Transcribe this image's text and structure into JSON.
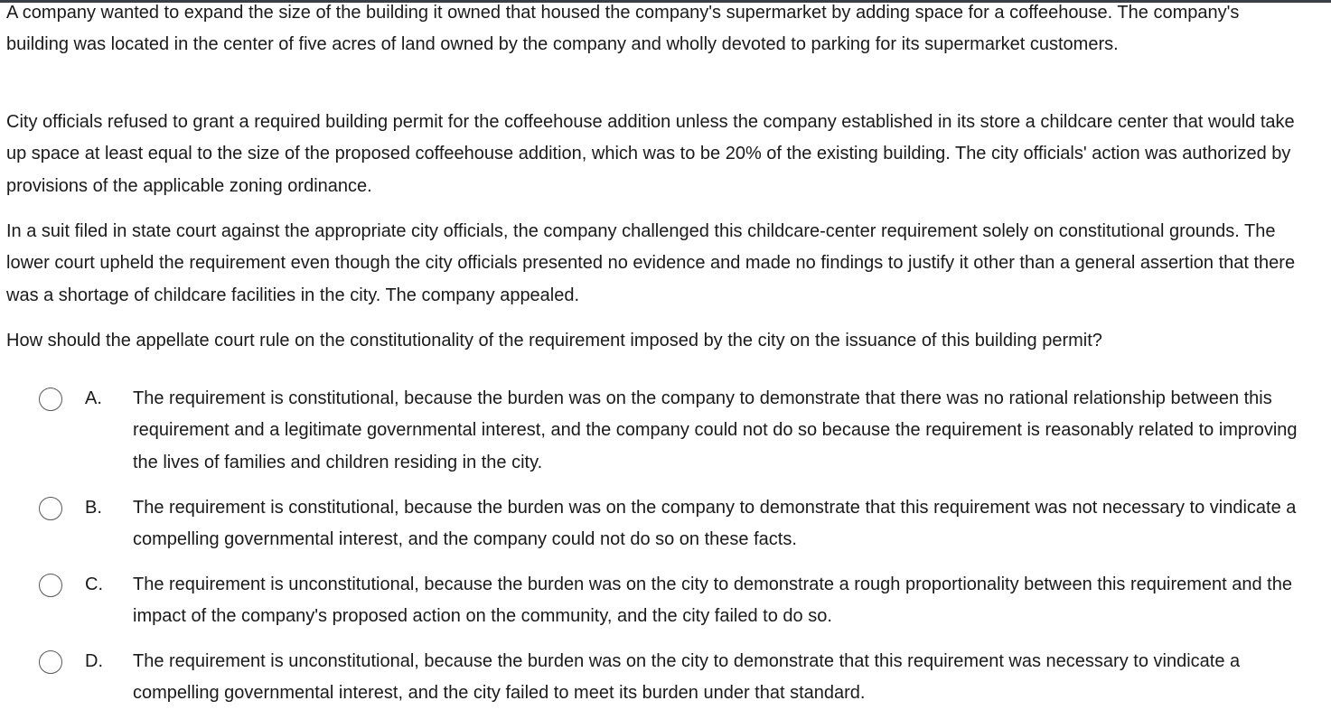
{
  "question": {
    "paragraphs": [
      "A company wanted to expand the size of the building it owned that housed the company's supermarket by adding space for a coffeehouse.  The company's building was located in the center of five acres of land owned by the company and wholly devoted to parking for its supermarket customers.",
      "City officials refused to grant a required building permit for the coffeehouse addition unless the company established in its store a childcare center that would take up space at least equal to the size of the proposed coffeehouse addition, which was to be 20% of the existing building.  The city officials' action was authorized by provisions of the applicable zoning ordinance.",
      "In a suit filed in state court against the appropriate city officials, the company challenged this childcare-center requirement solely on constitutional grounds.  The lower court upheld the requirement even though the city officials presented no evidence and made no findings to justify it other than a general assertion that there was a shortage of childcare facilities in the city.  The company appealed.",
      "How should the appellate court rule on the constitutionality of the requirement imposed by the city on the issuance of this building permit?"
    ]
  },
  "choices": [
    {
      "letter": "A.",
      "text": "The requirement is constitutional, because the burden was on the company to demonstrate that there was no rational relationship between this requirement and a legitimate governmental interest, and the company could not do so because the requirement is reasonably related to improving the lives of families and children residing in the city."
    },
    {
      "letter": "B.",
      "text": "The requirement is constitutional, because the burden was on the company to demonstrate that this requirement was not necessary to vindicate a compelling governmental interest, and the company could not do so on these facts."
    },
    {
      "letter": "C.",
      "text": "The requirement is unconstitutional, because the burden was on the city to demonstrate a rough proportionality between this requirement and the impact of the company's proposed action on the community, and the city failed to do so."
    },
    {
      "letter": "D.",
      "text": "The requirement is unconstitutional, because the burden was on the city to demonstrate that this requirement was necessary to vindicate a compelling governmental interest, and the city failed to meet its burden under that standard."
    }
  ]
}
